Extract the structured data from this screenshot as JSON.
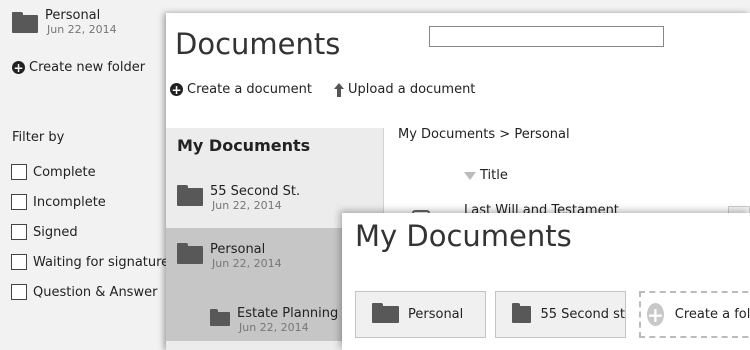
{
  "sidebar": {
    "folder": {
      "name": "Personal",
      "date": "Jun 22, 2014"
    },
    "create_folder_label": "Create new folder",
    "filter_title": "Filter by",
    "filters": [
      "Complete",
      "Incomplete",
      "Signed",
      "Waiting for signature",
      "Question & Answer"
    ]
  },
  "documents": {
    "title": "Documents",
    "search": {
      "value": "",
      "placeholder": ""
    },
    "actions": {
      "create": "Create a document",
      "upload": "Upload a document"
    },
    "tree": {
      "title": "My Documents",
      "items": [
        {
          "name": "55 Second St.",
          "date": "Jun 22, 2014"
        },
        {
          "name": "Personal",
          "date": "Jun 22, 2014"
        },
        {
          "name": "Estate Planning",
          "date": "Jun 22, 2014"
        }
      ]
    },
    "breadcrumb": "My Documents > Personal",
    "column_title": "Title",
    "rows": [
      "Last Will and Testament"
    ]
  },
  "my_documents": {
    "title": "My Documents",
    "folders": [
      "Personal",
      "55 Second st"
    ],
    "create_label": "Create a folder"
  },
  "colors": {
    "sidebar_bg": "#f2f2f2",
    "tree_bg": "#ececec",
    "selected_bg": "#c6c6c6",
    "folder_icon": "#585858"
  }
}
